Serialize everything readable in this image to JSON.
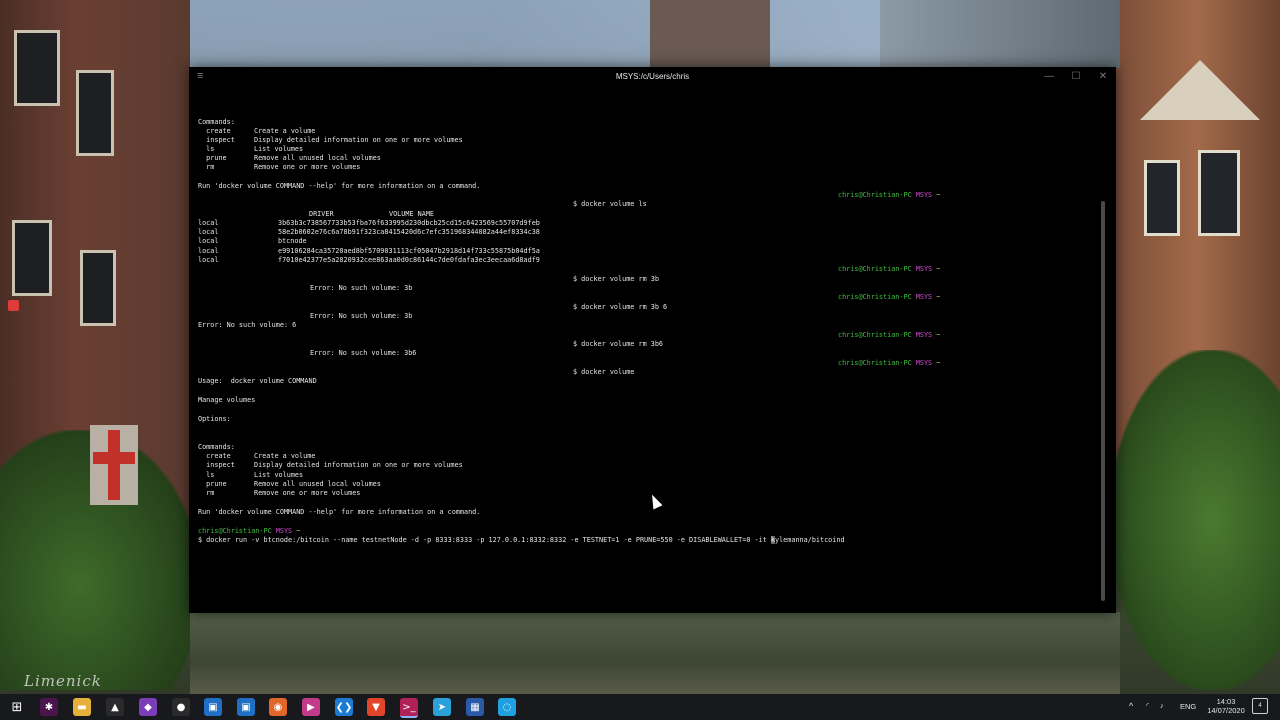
{
  "window": {
    "title": "MSYS:/c/Users/chris",
    "menu_glyph": "≡",
    "minimize_glyph": "—",
    "maximize_glyph": "☐",
    "close_glyph": "✕"
  },
  "terminal": {
    "help_block_1": {
      "commands_header": "Commands:",
      "rows": [
        {
          "cmd": "  create",
          "desc": "Create a volume"
        },
        {
          "cmd": "  inspect",
          "desc": "Display detailed information on one or more volumes"
        },
        {
          "cmd": "  ls",
          "desc": "List volumes"
        },
        {
          "cmd": "  prune",
          "desc": "Remove all unused local volumes"
        },
        {
          "cmd": "  rm",
          "desc": "Remove one or more volumes"
        }
      ],
      "footer": "Run 'docker volume COMMAND --help' for more information on a command."
    },
    "prompt_user": "chris@Christian-PC",
    "prompt_sys": "MSYS",
    "prompt_tilde": "~",
    "cmd_ls": "$ docker volume ls",
    "ls_header_driver": "DRIVER",
    "ls_header_volume": "VOLUME NAME",
    "ls_rows": [
      {
        "driver": "local",
        "name": "3b63b3c738567733b53fba76f633995d230dbcb25cd15c6423569c55707d9feb"
      },
      {
        "driver": "local",
        "name": "58e2b0602e76c6a78b91f323ca8415420d6c7efc351968344082a44ef8334c38"
      },
      {
        "driver": "local",
        "name": "btcnode"
      },
      {
        "driver": "local",
        "name": "e99106284ca35720aed8bf5709031113cf05047b2918d14f733c55875b04df5a"
      },
      {
        "driver": "local",
        "name": "f7010e42377e5a2820932cee863aa0d0c86144c7de0fdafa3ec3eecaa6d8adf9"
      }
    ],
    "cmd_rm_3b": "$ docker volume rm 3b",
    "err_3b_a": "Error: No such volume: 3b",
    "cmd_rm_3b_6": "$ docker volume rm 3b 6",
    "err_3b_b": "Error: No such volume: 3b",
    "err_6": "Error: No such volume: 6",
    "cmd_rm_3b6": "$ docker volume rm 3b6",
    "err_3b6": "Error: No such volume: 3b6",
    "cmd_volume": "$ docker volume",
    "usage": "Usage:  docker volume COMMAND",
    "manage": "Manage volumes",
    "options": "Options:",
    "help_block_2": {
      "commands_header": "Commands:",
      "rows": [
        {
          "cmd": "  create",
          "desc": "Create a volume"
        },
        {
          "cmd": "  inspect",
          "desc": "Display detailed information on one or more volumes"
        },
        {
          "cmd": "  ls",
          "desc": "List volumes"
        },
        {
          "cmd": "  prune",
          "desc": "Remove all unused local volumes"
        },
        {
          "cmd": "  rm",
          "desc": "Remove one or more volumes"
        }
      ],
      "footer": "Run 'docker volume COMMAND --help' for more information on a command."
    },
    "final_prompt_user": "chris@Christian-PC",
    "final_prompt_sys": "MSYS",
    "final_prompt_tilde": "~",
    "current_cmd_before": "$ docker run -v btcnode:/bitcoin --name testnetNode -d -p 8333:8333 -p 127.0.0.1:8332:8332 -e TESTNET=1 -e PRUNE=550 -e DISABLEWALLET=0 -it ",
    "current_cmd_cursor": "k",
    "current_cmd_after": "ylemanna/bitcoind"
  },
  "desktop": {
    "signature": "Limenick"
  },
  "taskbar": {
    "start_glyph": "⊞",
    "icons": [
      {
        "name": "slack-icon",
        "glyph": "✱",
        "color": "#4a154b"
      },
      {
        "name": "file-explorer-icon",
        "glyph": "▬",
        "color": "#e6b13a"
      },
      {
        "name": "photo-app-icon",
        "glyph": "▲",
        "color": "#2b2b2b"
      },
      {
        "name": "vpn-icon",
        "glyph": "◆",
        "color": "#7a3fb8"
      },
      {
        "name": "obs-icon",
        "glyph": "●",
        "color": "#2a2a2a"
      },
      {
        "name": "window-app-icon",
        "glyph": "▣",
        "color": "#1f6fc4"
      },
      {
        "name": "window-app-2-icon",
        "glyph": "▣",
        "color": "#1f6fc4"
      },
      {
        "name": "firefox-icon",
        "glyph": "◉",
        "color": "#e0662a"
      },
      {
        "name": "video-app-icon",
        "glyph": "▶",
        "color": "#c23a8a"
      },
      {
        "name": "vscode-icon",
        "glyph": "❮❯",
        "color": "#1a7ad4"
      },
      {
        "name": "brave-icon",
        "glyph": "▼",
        "color": "#e0462a"
      },
      {
        "name": "terminal-icon",
        "glyph": ">_",
        "color": "#b2205a"
      },
      {
        "name": "telegram-icon",
        "glyph": "➤",
        "color": "#2aa1d9"
      },
      {
        "name": "calculator-icon",
        "glyph": "▦",
        "color": "#2b5aa8"
      },
      {
        "name": "app-blue-icon",
        "glyph": "◌",
        "color": "#1fa0e0"
      }
    ],
    "tray": {
      "chevron": "^",
      "net": "◜",
      "vol": "♪",
      "lang": "ENG",
      "time": "14:03",
      "date": "14/07/2020",
      "notif": "4"
    }
  }
}
